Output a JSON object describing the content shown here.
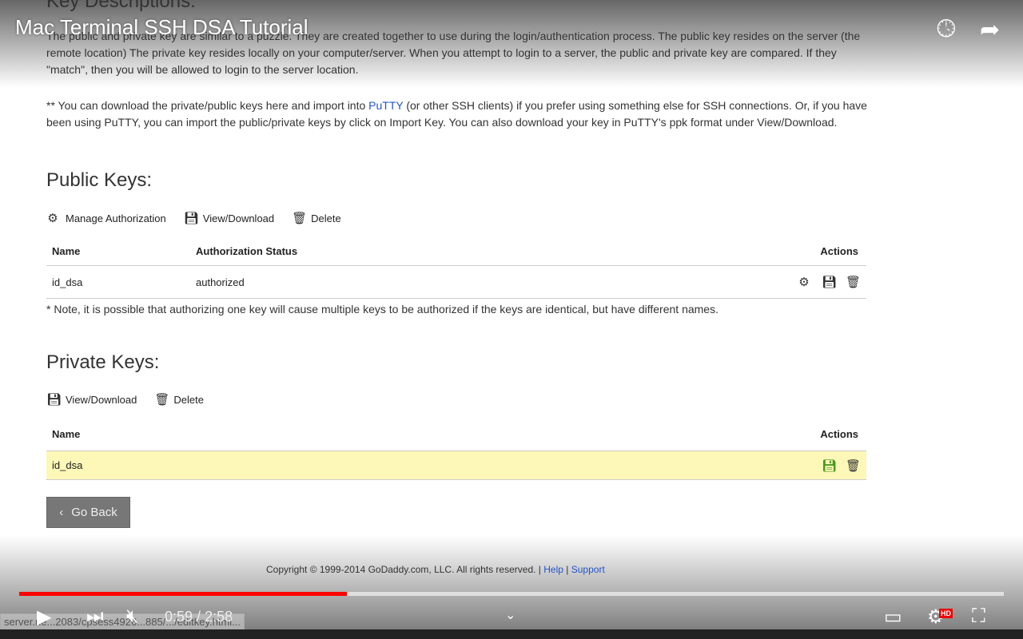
{
  "video": {
    "title": "Mac Terminal SSH DSA Tutorial",
    "current_time": "0:59",
    "duration": "2:58",
    "progress": 0.333,
    "time_sep": " / ",
    "status_url": "server.ne...2083/cpsess4926...885/.../editkey.html...",
    "hd_badge": "HD",
    "accent": "#ff0000"
  },
  "page": {
    "desc_heading": "Key Descriptions:",
    "desc_para": "The public and private key are similar to a puzzle. They are created together to use during the login/authentication process. The public key resides on the server (the remote location) The private key resides locally on your computer/server. When you attempt to login to a server, the public and private key are compared. If they \"match\", then you will be allowed to login to the server location.",
    "putty_pre": "** You can download the private/public keys here and import into ",
    "putty_link": "PuTTY",
    "putty_post": " (or other SSH clients) if you prefer using something else for SSH connections. Or, if you have been using PuTTY, you can import the public/private keys by click on Import Key. You can also download your key in PuTTY's ppk format under View/Download.",
    "public": {
      "heading": "Public Keys:",
      "actions": [
        "Manage Authorization",
        "View/Download",
        "Delete"
      ],
      "columns": [
        "Name",
        "Authorization Status",
        "Actions"
      ],
      "rows": [
        {
          "name": "id_dsa",
          "status": "authorized"
        }
      ],
      "note": "* Note, it is possible that authorizing one key will cause multiple keys to be authorized if the keys are identical, but have different names."
    },
    "private": {
      "heading": "Private Keys:",
      "actions": [
        "View/Download",
        "Delete"
      ],
      "columns": [
        "Name",
        "Actions"
      ],
      "rows": [
        {
          "name": "id_dsa"
        }
      ]
    },
    "go_back": "Go Back",
    "footer": {
      "copyright": "Copyright © 1999-2014 GoDaddy.com, LLC. All rights reserved. |",
      "help": "Help",
      "sep": "|",
      "support": "Support"
    }
  }
}
